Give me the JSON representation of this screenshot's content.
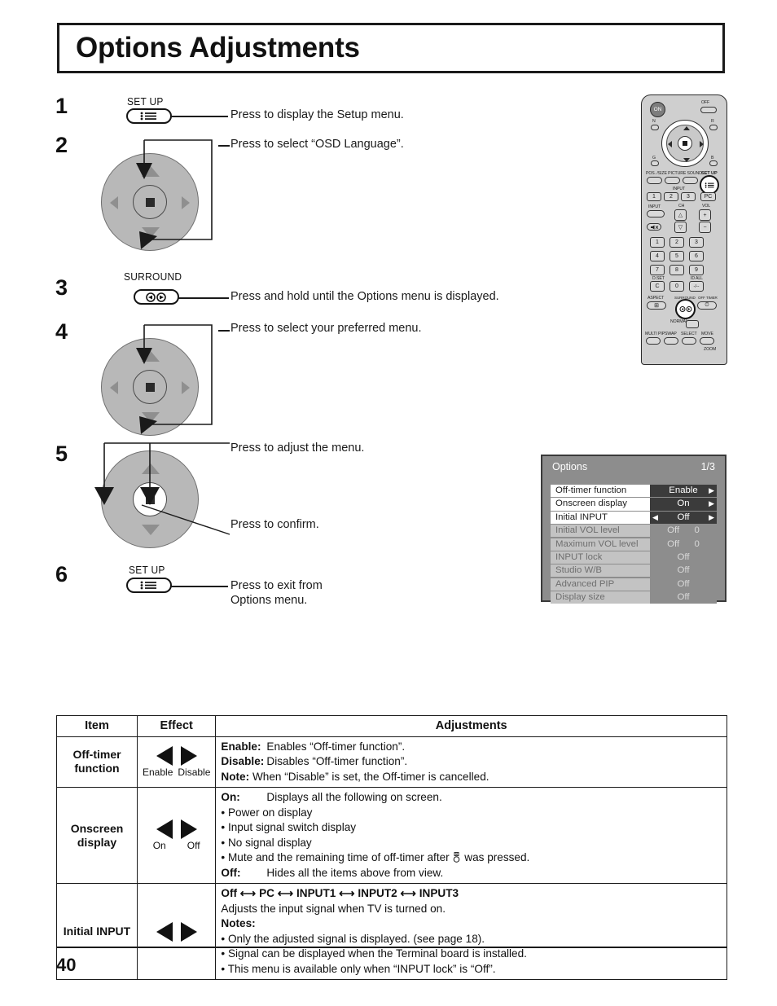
{
  "header": {
    "title": "Options Adjustments"
  },
  "steps": [
    {
      "number": "1",
      "button_label": "SET UP",
      "button_icon": "setup-menu-icon",
      "callout": "Press to display the Setup menu."
    },
    {
      "number": "2",
      "callout": "Press to select “OSD Language”.",
      "control": "cursor-pad-up-down"
    },
    {
      "number": "3",
      "button_label": "SURROUND",
      "button_icon": "surround-icon",
      "callout": "Press and hold until the Options menu is displayed."
    },
    {
      "number": "4",
      "callout": "Press to select your preferred menu.",
      "control": "cursor-pad-up-down"
    },
    {
      "number": "5",
      "callout": "Press to adjust the menu.",
      "callout2": "Press to confirm.",
      "control": "cursor-pad-left-right"
    },
    {
      "number": "6",
      "button_label": "SET UP",
      "button_icon": "setup-menu-icon",
      "callout": "Press to exit from\nOptions menu."
    }
  ],
  "osd": {
    "title": "Options",
    "page_indicator": "1/3",
    "rows": [
      {
        "label": "Off-timer function",
        "value": "Enable",
        "dim": false,
        "arrow_left": false,
        "arrow_right": true
      },
      {
        "label": "Onscreen display",
        "value": "On",
        "dim": false,
        "arrow_left": false,
        "arrow_right": true
      },
      {
        "label": "Initial INPUT",
        "value": "Off",
        "dim": false,
        "arrow_left": true,
        "arrow_right": true
      },
      {
        "label": "Initial VOL level",
        "value": "Off",
        "value2": "0",
        "dim": true
      },
      {
        "label": "Maximum VOL level",
        "value": "Off",
        "value2": "0",
        "dim": true
      },
      {
        "label": "INPUT lock",
        "value": "Off",
        "dim": true
      },
      {
        "label": "Studio W/B",
        "value": "Off",
        "dim": true
      },
      {
        "label": "Advanced PIP",
        "value": "Off",
        "dim": true
      },
      {
        "label": "Display size",
        "value": "Off",
        "dim": true
      }
    ]
  },
  "remote": {
    "power_on": "ON",
    "power_off": "OFF",
    "label_n": "N",
    "label_r": "R",
    "label_b": "B",
    "label_g": "G",
    "row_labels": "POS. /SIZE  PICTURE  SOUND",
    "setup_label": "SET UP",
    "input_group": "INPUT",
    "input_keys": [
      "1",
      "2",
      "3",
      "PC"
    ],
    "input_button": "INPUT",
    "ch_label": "CH",
    "vol_label": "VOL",
    "numpad": [
      "1",
      "2",
      "3",
      "4",
      "5",
      "6",
      "7",
      "8",
      "9",
      "C",
      "0",
      "-/--"
    ],
    "d_set": "D.SET",
    "id_all": "ID ALL",
    "aspect": "ASPECT",
    "surround": "SURROUND",
    "off_timer": "OFF TIMER",
    "normal": "NORMAL",
    "bottom_keys": [
      "MULTI PIP",
      "SWAP",
      "SELECT",
      "MOVE"
    ],
    "zoom_label": "ZOOM"
  },
  "table": {
    "headers": [
      "Item",
      "Effect",
      "Adjustments"
    ],
    "rows": [
      {
        "item": "Off-timer\nfunction",
        "effect_left": "Enable",
        "effect_right": "Disable",
        "adjustments": [
          {
            "term": "Enable:",
            "text": "Enables “Off-timer function”."
          },
          {
            "term": "Disable:",
            "text": "Disables “Off-timer function”."
          },
          {
            "term": "Note:",
            "text": "When “Disable” is set, the Off-timer is cancelled."
          }
        ]
      },
      {
        "item": "Onscreen\ndisplay",
        "effect_left": "On",
        "effect_right": "Off",
        "adjustments": [
          {
            "term": "On:",
            "text": "Displays all the following on screen."
          },
          {
            "bullet": "• Power on display"
          },
          {
            "bullet": "• Input signal switch display"
          },
          {
            "bullet": "• No signal display"
          },
          {
            "bullet": "• Mute and the remaining time of off-timer after ",
            "icon": "mute-button-icon",
            "after": " was pressed."
          },
          {
            "term": "Off:",
            "text": "Hides all the items above from view."
          }
        ]
      },
      {
        "item": "Initial INPUT",
        "effect_left": "",
        "effect_right": "",
        "adjustments": [
          {
            "headline": "Off ⟷ PC ⟷ INPUT1 ⟷ INPUT2 ⟷ INPUT3"
          },
          {
            "plain": "Adjusts the input signal when TV is turned on."
          },
          {
            "term": "Notes:",
            "text": ""
          },
          {
            "bullet": "• Only the adjusted signal is displayed. (see page 18)."
          },
          {
            "bullet": "• Signal can be displayed when the Terminal board is installed."
          },
          {
            "bullet": "• This menu is available only when “INPUT lock” is “Off”."
          }
        ]
      }
    ]
  },
  "footer": {
    "page_number": "40"
  }
}
